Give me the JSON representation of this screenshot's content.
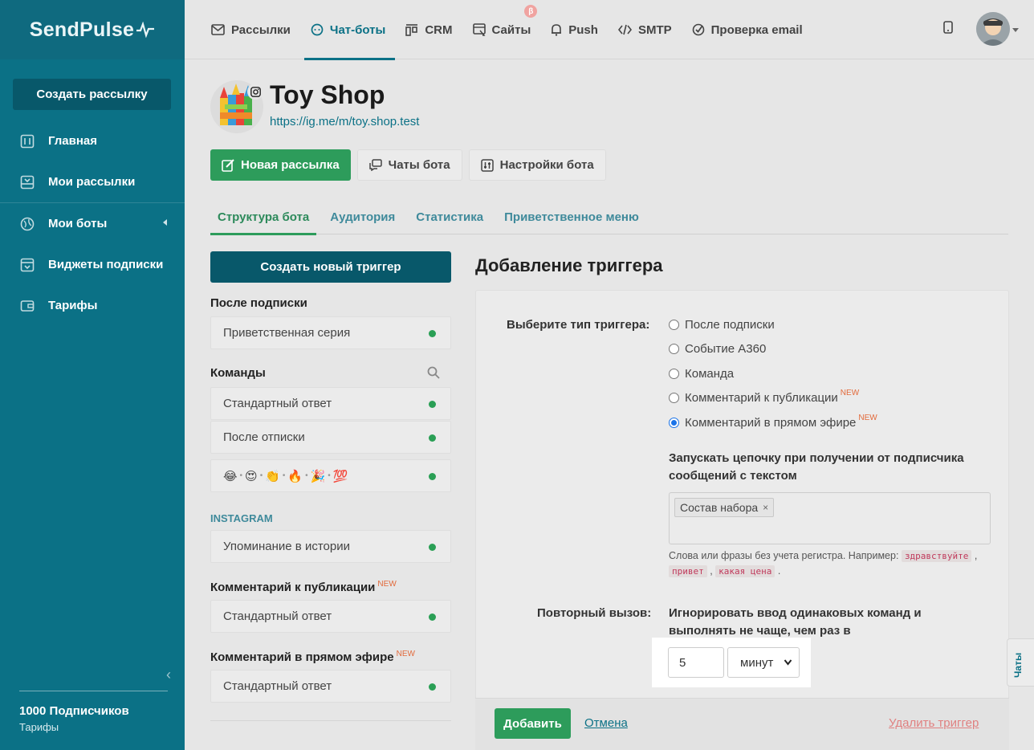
{
  "brand": {
    "logo": "SendPulse"
  },
  "sidebar": {
    "create_label": "Создать рассылку",
    "items": [
      {
        "label": "Главная",
        "icon": "dashboard-icon"
      },
      {
        "label": "Мои рассылки",
        "icon": "inbox-icon"
      },
      {
        "label": "Мои боты",
        "icon": "globe-icon"
      },
      {
        "label": "Виджеты подписки",
        "icon": "widget-icon"
      },
      {
        "label": "Тарифы",
        "icon": "wallet-icon"
      }
    ],
    "subscribers": "1000 Подписчиков",
    "tariffs_link": "Тарифы"
  },
  "topnav": {
    "items": [
      {
        "label": "Рассылки",
        "icon": "mail-icon"
      },
      {
        "label": "Чат-боты",
        "icon": "chat-icon",
        "active": true
      },
      {
        "label": "CRM",
        "icon": "crm-icon"
      },
      {
        "label": "Сайты",
        "icon": "site-icon",
        "badge": "β"
      },
      {
        "label": "Push",
        "icon": "bell-icon"
      },
      {
        "label": "SMTP",
        "icon": "code-icon"
      },
      {
        "label": "Проверка email",
        "icon": "check-icon"
      }
    ]
  },
  "bot": {
    "title": "Toy Shop",
    "link": "https://ig.me/m/toy.shop.test"
  },
  "actions": {
    "new_mailing": "Новая рассылка",
    "bot_chats": "Чаты бота",
    "bot_settings": "Настройки бота"
  },
  "tabs": [
    "Структура бота",
    "Аудитория",
    "Статистика",
    "Приветственное меню"
  ],
  "left": {
    "new_trigger": "Создать новый триггер",
    "after_subscribe": {
      "title": "После подписки",
      "items": [
        "Приветственная серия"
      ]
    },
    "commands": {
      "title": "Команды",
      "items": [
        "Стандартный ответ",
        "После отписки"
      ]
    },
    "emoji_row": [
      "😂",
      "😍",
      "👏",
      "🔥",
      "🎉",
      "💯"
    ],
    "instagram": {
      "title": "INSTAGRAM",
      "items": [
        "Упоминание в истории"
      ]
    },
    "post_comment": {
      "title": "Комментарий к публикации",
      "badge": "NEW",
      "items": [
        "Стандартный ответ"
      ]
    },
    "live_comment": {
      "title": "Комментарий в прямом эфире",
      "badge": "NEW",
      "items": [
        "Стандартный ответ"
      ]
    }
  },
  "form": {
    "title": "Добавление триггера",
    "type_label": "Выберите тип триггера:",
    "options": [
      {
        "label": "После подписки",
        "checked": false
      },
      {
        "label": "Событие A360",
        "checked": false
      },
      {
        "label": "Команда",
        "checked": false
      },
      {
        "label": "Комментарий к публикации",
        "badge": "NEW",
        "checked": false
      },
      {
        "label": "Комментарий в прямом эфире",
        "badge": "NEW",
        "checked": true
      }
    ],
    "run_chain_label": "Запускать цепочку при получении от подписчика сообщений с текстом",
    "tag": "Состав набора",
    "hint_prefix": "Слова или фразы без учета регистра. Например:",
    "hint_examples": [
      "здравствуйте",
      "привет",
      "какая цена"
    ],
    "repeat_label": "Повторный вызов:",
    "repeat_desc": "Игнорировать ввод одинаковых команд и выполнять не чаще, чем раз в",
    "repeat_value": "5",
    "repeat_unit": "минут",
    "add_button": "Добавить",
    "cancel_link": "Отмена",
    "delete_link": "Удалить триггер"
  },
  "chats_tab": "Чаты"
}
